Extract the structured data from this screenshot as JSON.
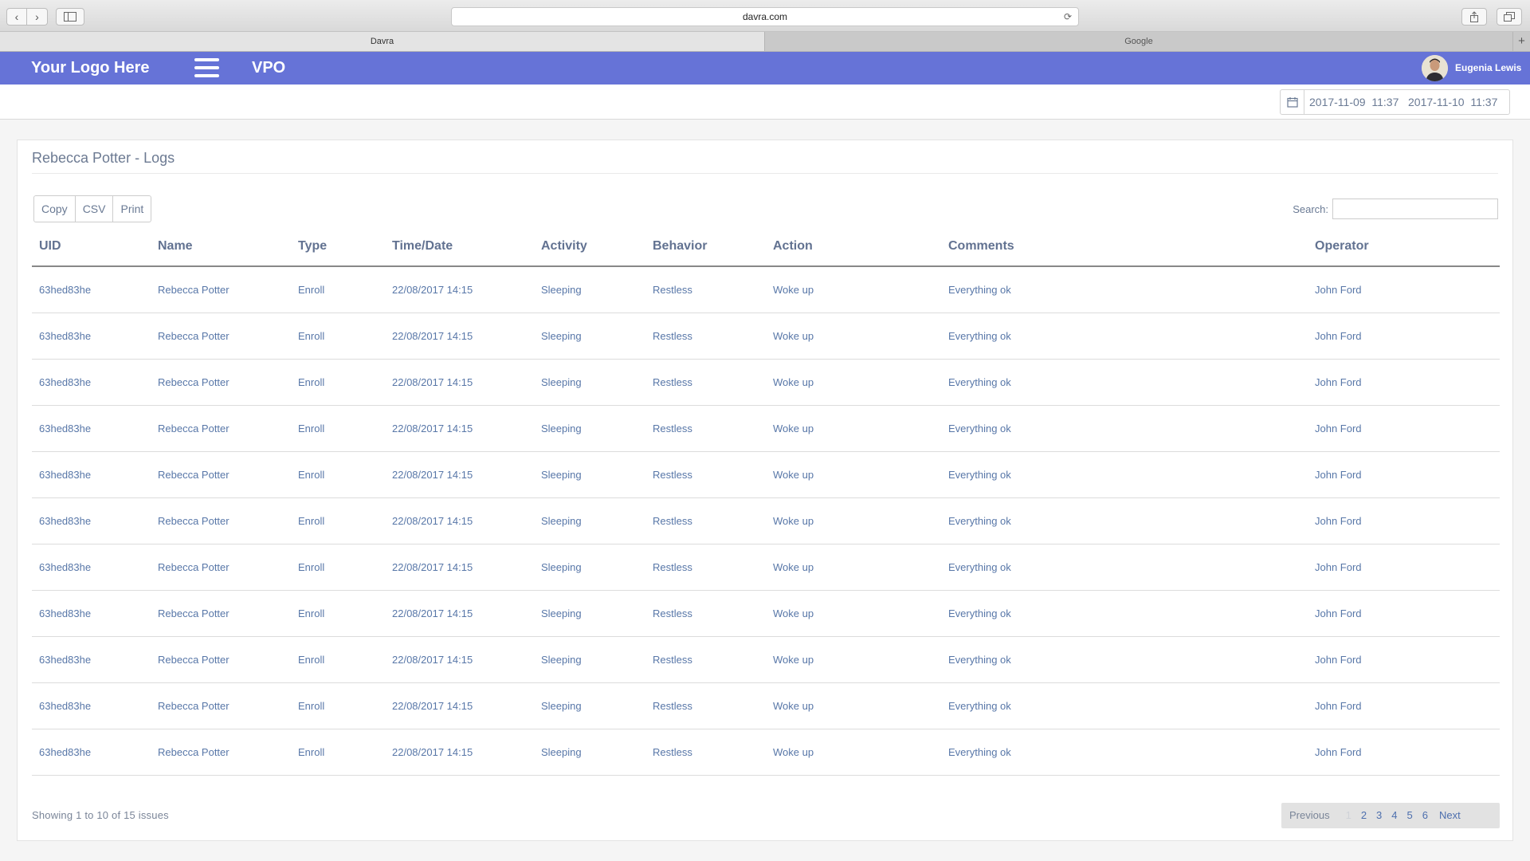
{
  "browser": {
    "url": "davra.com",
    "tabs": [
      {
        "label": "Davra",
        "active": true
      },
      {
        "label": "Google",
        "active": false
      }
    ]
  },
  "header": {
    "logo": "Your Logo Here",
    "app_title": "VPO",
    "user_name": "Eugenia Lewis",
    "accent_color": "#6673d7"
  },
  "daterange": {
    "text": "2017-11-09  11:37   2017-11-10  11:37"
  },
  "panel": {
    "title": "Rebecca Potter - Logs"
  },
  "toolbar": {
    "copy_label": "Copy",
    "csv_label": "CSV",
    "print_label": "Print"
  },
  "search": {
    "label": "Search:",
    "value": ""
  },
  "table": {
    "columns": [
      "UID",
      "Name",
      "Type",
      "Time/Date",
      "Activity",
      "Behavior",
      "Action",
      "Comments",
      "Operator"
    ],
    "rows": [
      [
        "63hed83he",
        "Rebecca Potter",
        "Enroll",
        "22/08/2017 14:15",
        "Sleeping",
        "Restless",
        "Woke up",
        "Everything ok",
        "John Ford"
      ],
      [
        "63hed83he",
        "Rebecca Potter",
        "Enroll",
        "22/08/2017 14:15",
        "Sleeping",
        "Restless",
        "Woke up",
        "Everything ok",
        "John Ford"
      ],
      [
        "63hed83he",
        "Rebecca Potter",
        "Enroll",
        "22/08/2017 14:15",
        "Sleeping",
        "Restless",
        "Woke up",
        "Everything ok",
        "John Ford"
      ],
      [
        "63hed83he",
        "Rebecca Potter",
        "Enroll",
        "22/08/2017 14:15",
        "Sleeping",
        "Restless",
        "Woke up",
        "Everything ok",
        "John Ford"
      ],
      [
        "63hed83he",
        "Rebecca Potter",
        "Enroll",
        "22/08/2017 14:15",
        "Sleeping",
        "Restless",
        "Woke up",
        "Everything ok",
        "John Ford"
      ],
      [
        "63hed83he",
        "Rebecca Potter",
        "Enroll",
        "22/08/2017 14:15",
        "Sleeping",
        "Restless",
        "Woke up",
        "Everything ok",
        "John Ford"
      ],
      [
        "63hed83he",
        "Rebecca Potter",
        "Enroll",
        "22/08/2017 14:15",
        "Sleeping",
        "Restless",
        "Woke up",
        "Everything ok",
        "John Ford"
      ],
      [
        "63hed83he",
        "Rebecca Potter",
        "Enroll",
        "22/08/2017 14:15",
        "Sleeping",
        "Restless",
        "Woke up",
        "Everything ok",
        "John Ford"
      ],
      [
        "63hed83he",
        "Rebecca Potter",
        "Enroll",
        "22/08/2017 14:15",
        "Sleeping",
        "Restless",
        "Woke up",
        "Everything ok",
        "John Ford"
      ],
      [
        "63hed83he",
        "Rebecca Potter",
        "Enroll",
        "22/08/2017 14:15",
        "Sleeping",
        "Restless",
        "Woke up",
        "Everything ok",
        "John Ford"
      ],
      [
        "63hed83he",
        "Rebecca Potter",
        "Enroll",
        "22/08/2017 14:15",
        "Sleeping",
        "Restless",
        "Woke up",
        "Everything ok",
        "John Ford"
      ]
    ]
  },
  "footer": {
    "info": "Showing 1 to 10 of 15 issues"
  },
  "pagination": {
    "previous": "Previous",
    "pages": [
      "1",
      "2",
      "3",
      "4",
      "5",
      "6"
    ],
    "current": "1",
    "next": "Next"
  }
}
